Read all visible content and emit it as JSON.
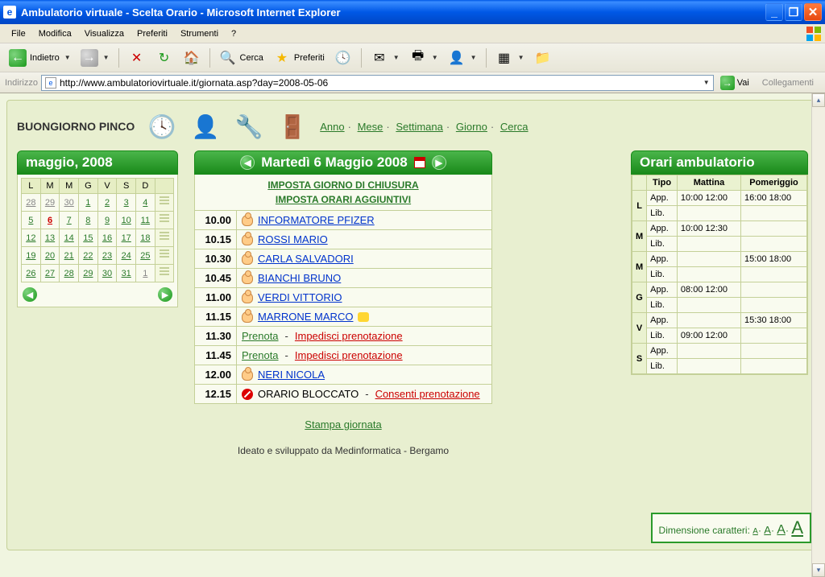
{
  "window": {
    "title": "Ambulatorio virtuale - Scelta Orario - Microsoft Internet Explorer"
  },
  "menu": {
    "file": "File",
    "modifica": "Modifica",
    "visualizza": "Visualizza",
    "preferiti": "Preferiti",
    "strumenti": "Strumenti",
    "help": "?"
  },
  "toolbar": {
    "back": "Indietro",
    "search": "Cerca",
    "favorites": "Preferiti"
  },
  "address": {
    "label": "Indirizzo",
    "url": "http://www.ambulatoriovirtuale.it/giornata.asp?day=2008-05-06",
    "go": "Vai",
    "links": "Collegamenti"
  },
  "greeting": "BUONGIORNO PINCO",
  "navlinks": {
    "anno": "Anno",
    "mese": "Mese",
    "settimana": "Settimana",
    "giorno": "Giorno",
    "cerca": "Cerca"
  },
  "minical": {
    "title": "maggio, 2008",
    "daynames": [
      "L",
      "M",
      "M",
      "G",
      "V",
      "S",
      "D"
    ],
    "weeks": [
      [
        {
          "d": "28",
          "out": true
        },
        {
          "d": "29",
          "out": true
        },
        {
          "d": "30",
          "out": true
        },
        {
          "d": "1"
        },
        {
          "d": "2"
        },
        {
          "d": "3"
        },
        {
          "d": "4"
        }
      ],
      [
        {
          "d": "5"
        },
        {
          "d": "6",
          "today": true
        },
        {
          "d": "7"
        },
        {
          "d": "8"
        },
        {
          "d": "9"
        },
        {
          "d": "10"
        },
        {
          "d": "11"
        }
      ],
      [
        {
          "d": "12"
        },
        {
          "d": "13"
        },
        {
          "d": "14"
        },
        {
          "d": "15"
        },
        {
          "d": "16"
        },
        {
          "d": "17"
        },
        {
          "d": "18"
        }
      ],
      [
        {
          "d": "19"
        },
        {
          "d": "20"
        },
        {
          "d": "21"
        },
        {
          "d": "22"
        },
        {
          "d": "23"
        },
        {
          "d": "24"
        },
        {
          "d": "25"
        }
      ],
      [
        {
          "d": "26"
        },
        {
          "d": "27"
        },
        {
          "d": "28"
        },
        {
          "d": "29"
        },
        {
          "d": "30"
        },
        {
          "d": "31"
        },
        {
          "d": "1",
          "out": true
        }
      ]
    ]
  },
  "day": {
    "title": "Martedì 6 Maggio 2008",
    "set_closure": "IMPOSTA GIORNO DI CHIUSURA",
    "set_extra": "IMPOSTA ORARI AGGIUNTIVI",
    "slots": [
      {
        "time": "10.00",
        "type": "patient",
        "name": "INFORMATORE PFIZER"
      },
      {
        "time": "10.15",
        "type": "patient",
        "name": "ROSSI MARIO"
      },
      {
        "time": "10.30",
        "type": "patient",
        "name": "CARLA SALVADORI"
      },
      {
        "time": "10.45",
        "type": "patient",
        "name": "BIANCHI BRUNO"
      },
      {
        "time": "11.00",
        "type": "patient",
        "name": "VERDI VITTORIO"
      },
      {
        "time": "11.15",
        "type": "patient",
        "name": "MARRONE MARCO",
        "note": true
      },
      {
        "time": "11.30",
        "type": "free",
        "book": "Prenota",
        "block": "Impedisci prenotazione"
      },
      {
        "time": "11.45",
        "type": "free",
        "book": "Prenota",
        "block": "Impedisci prenotazione"
      },
      {
        "time": "12.00",
        "type": "patient",
        "name": "NERI NICOLA"
      },
      {
        "time": "12.15",
        "type": "blocked",
        "text": "ORARIO BLOCCATO",
        "allow": "Consenti prenotazione"
      }
    ],
    "print": "Stampa giornata"
  },
  "footer": "Ideato e sviluppato da Medinformatica - Bergamo",
  "hours": {
    "title": "Orari ambulatorio",
    "cols": {
      "tipo": "Tipo",
      "mattina": "Mattina",
      "pomeriggio": "Pomeriggio"
    },
    "rows": [
      {
        "day": "L",
        "app_m": "10:00 12:00",
        "app_p": "16:00 18:00",
        "lib_m": "",
        "lib_p": ""
      },
      {
        "day": "M",
        "app_m": "10:00 12:30",
        "app_p": "",
        "lib_m": "",
        "lib_p": ""
      },
      {
        "day": "M",
        "app_m": "",
        "app_p": "15:00 18:00",
        "lib_m": "",
        "lib_p": ""
      },
      {
        "day": "G",
        "app_m": "08:00 12:00",
        "app_p": "",
        "lib_m": "",
        "lib_p": ""
      },
      {
        "day": "V",
        "app_m": "",
        "app_p": "15:30 18:00",
        "lib_m": "09:00 12:00",
        "lib_p": ""
      },
      {
        "day": "S",
        "app_m": "",
        "app_p": "",
        "lib_m": "",
        "lib_p": ""
      }
    ],
    "app": "App.",
    "lib": "Lib."
  },
  "fontsize": {
    "label": "Dimensione caratteri:",
    "a": "A"
  }
}
